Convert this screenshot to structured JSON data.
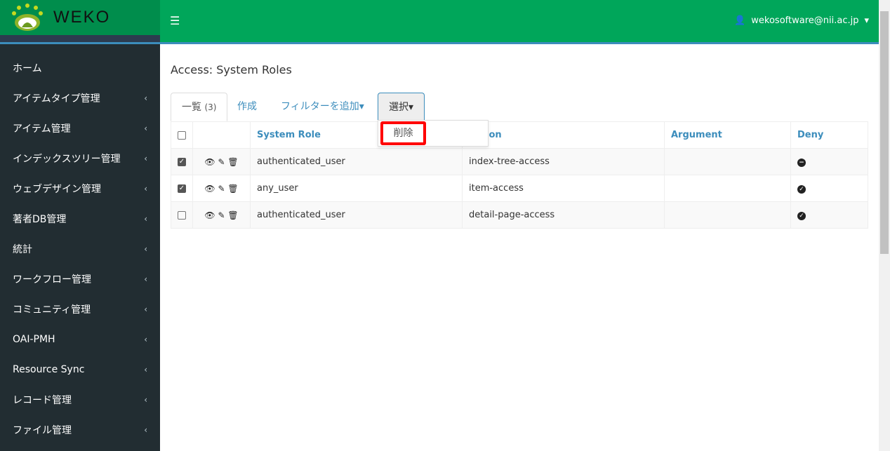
{
  "app": {
    "logo_text": "WEKO",
    "user": "wekosoftware@nii.ac.jp"
  },
  "sidebar": {
    "items": [
      {
        "label": "ホーム",
        "chevron": false
      },
      {
        "label": "アイテムタイプ管理",
        "chevron": true
      },
      {
        "label": "アイテム管理",
        "chevron": true
      },
      {
        "label": "インデックスツリー管理",
        "chevron": true
      },
      {
        "label": "ウェブデザイン管理",
        "chevron": true
      },
      {
        "label": "著者DB管理",
        "chevron": true
      },
      {
        "label": "統計",
        "chevron": true
      },
      {
        "label": "ワークフロー管理",
        "chevron": true
      },
      {
        "label": "コミュニティ管理",
        "chevron": true
      },
      {
        "label": "OAI-PMH",
        "chevron": true
      },
      {
        "label": "Resource Sync",
        "chevron": true
      },
      {
        "label": "レコード管理",
        "chevron": true
      },
      {
        "label": "ファイル管理",
        "chevron": true
      }
    ]
  },
  "page": {
    "title": "Access: System Roles"
  },
  "tabs": {
    "list": "一覧",
    "count": "(3)",
    "create": "作成",
    "filter": "フィルターを追加",
    "select": "選択"
  },
  "dropdown": {
    "delete": "削除"
  },
  "table": {
    "headers": {
      "role": "System Role",
      "action": "Action",
      "argument": "Argument",
      "deny": "Deny"
    },
    "rows": [
      {
        "checked": true,
        "role": "authenticated_user",
        "action": "index-tree-access",
        "argument": "",
        "deny": "minus"
      },
      {
        "checked": true,
        "role": "any_user",
        "action": "item-access",
        "argument": "",
        "deny": "check"
      },
      {
        "checked": false,
        "role": "authenticated_user",
        "action": "detail-page-access",
        "argument": "",
        "deny": "check"
      }
    ]
  },
  "colors": {
    "header": "#00a65a",
    "logo_bg": "#008d4c",
    "sidebar": "#222d32",
    "link": "#3c8dbc",
    "highlight": "#ff0000"
  }
}
